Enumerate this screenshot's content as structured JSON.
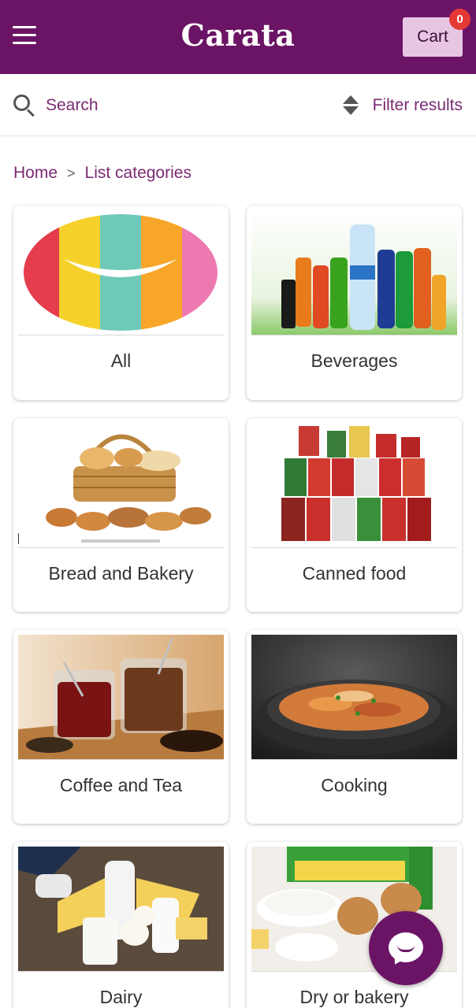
{
  "header": {
    "brand": "Carata",
    "cart_label": "Cart",
    "cart_count": "0",
    "menu_icon": "menu-icon",
    "color": "#6b1466"
  },
  "toolbar": {
    "search_label": "Search",
    "filter_label": "Filter results",
    "search_icon": "search-icon",
    "filter_icon": "sort-icon"
  },
  "breadcrumb": {
    "home": "Home",
    "separator": ">",
    "current": "List categories"
  },
  "categories": [
    {
      "label": "All"
    },
    {
      "label": "Beverages"
    },
    {
      "label": "Bread and Bakery"
    },
    {
      "label": "Canned food"
    },
    {
      "label": "Coffee and Tea"
    },
    {
      "label": "Cooking"
    },
    {
      "label": "Dairy"
    },
    {
      "label": "Dry or bakery"
    }
  ],
  "chat": {
    "icon": "chat-icon"
  }
}
